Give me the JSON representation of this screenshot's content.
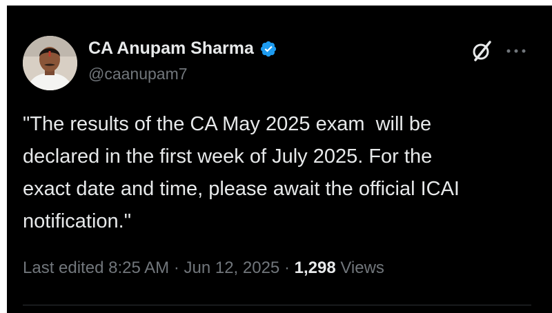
{
  "author": {
    "display_name": "CA Anupam Sharma",
    "handle": "@caanupam7",
    "verified": true
  },
  "tweet": {
    "text": "\"The results of the CA May 2025 exam  will be\ndeclared in the first week of July 2025. For the\nexact date and time, please await the official ICAI\nnotification.\""
  },
  "meta": {
    "edited_label": "Last edited",
    "time": "8:25 AM",
    "separator": " · ",
    "date": "Jun 12, 2025",
    "views_count": "1,298",
    "views_label": "Views"
  },
  "icons": {
    "verified": "verified-badge-icon",
    "grok": "grok-icon",
    "more": "more-options-icon"
  },
  "colors": {
    "background": "#000000",
    "text_primary": "#e7e9ea",
    "text_secondary": "#71767b",
    "verified_blue": "#1d9bf0",
    "divider": "#2f3336"
  }
}
